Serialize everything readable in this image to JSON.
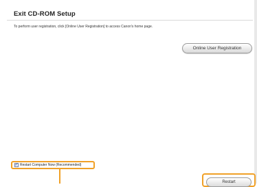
{
  "window": {
    "title": "Exit CD-ROM Setup",
    "description": "To perform user registration, click [Online User Registration] to access Canon's home page."
  },
  "buttons": {
    "online_registration": "Online User Registration",
    "restart": "Restart"
  },
  "restart_option": {
    "label": "Restart Computer Now (Recommended)",
    "checked": true,
    "check_mark": "✓"
  },
  "colors": {
    "highlight": "#f0a026",
    "background": "#ffffff"
  }
}
